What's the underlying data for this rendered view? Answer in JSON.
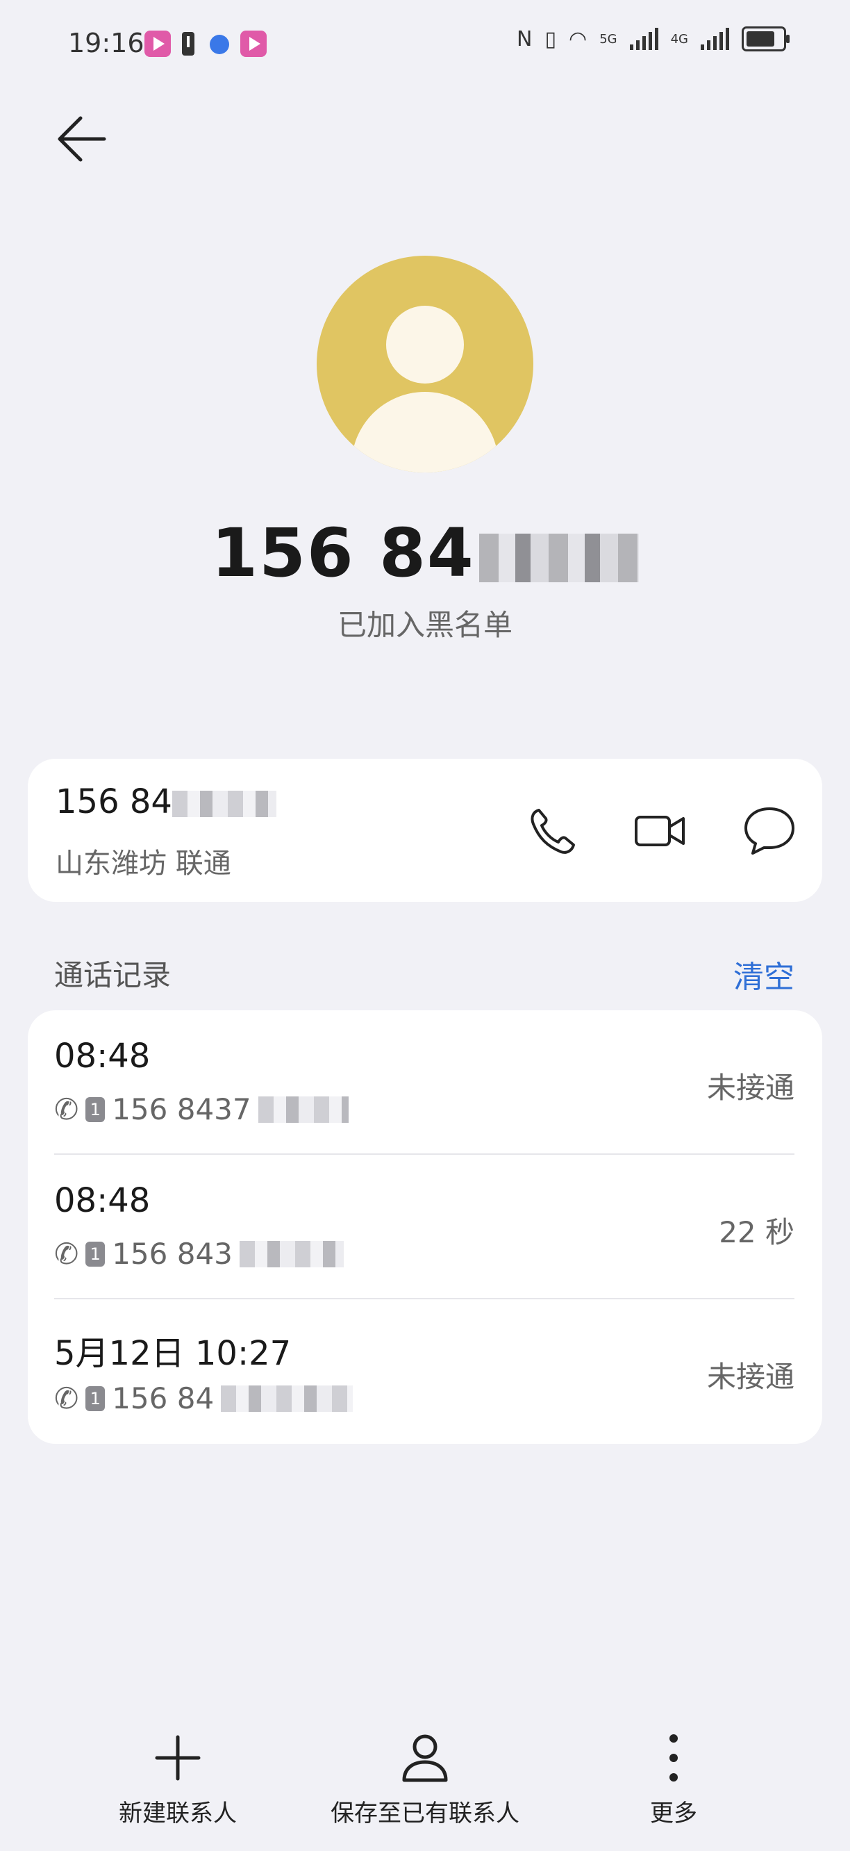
{
  "status_bar": {
    "time": "19:16",
    "network_5g": "5G",
    "network_4g": "4G"
  },
  "contact": {
    "number_visible": "156 84",
    "subtitle": "已加入黑名单"
  },
  "number_card": {
    "number_visible": "156 84",
    "location": "山东潍坊 联通"
  },
  "call_log": {
    "title": "通话记录",
    "clear_label": "清空",
    "entries": [
      {
        "time": "08:48",
        "number_visible": "156 8437",
        "sim": "1",
        "status": "未接通"
      },
      {
        "time": "08:48",
        "number_visible": "156 843",
        "sim": "1",
        "status": "22 秒"
      },
      {
        "time": "5月12日 10:27",
        "number_visible": "156 84",
        "sim": "1",
        "status": "未接通"
      }
    ]
  },
  "bottom_bar": {
    "new_contact": "新建联系人",
    "save_existing": "保存至已有联系人",
    "more": "更多"
  },
  "colors": {
    "avatar_bg": "#e0c562",
    "accent": "#2f6fd6",
    "page_bg": "#f1f1f6"
  }
}
